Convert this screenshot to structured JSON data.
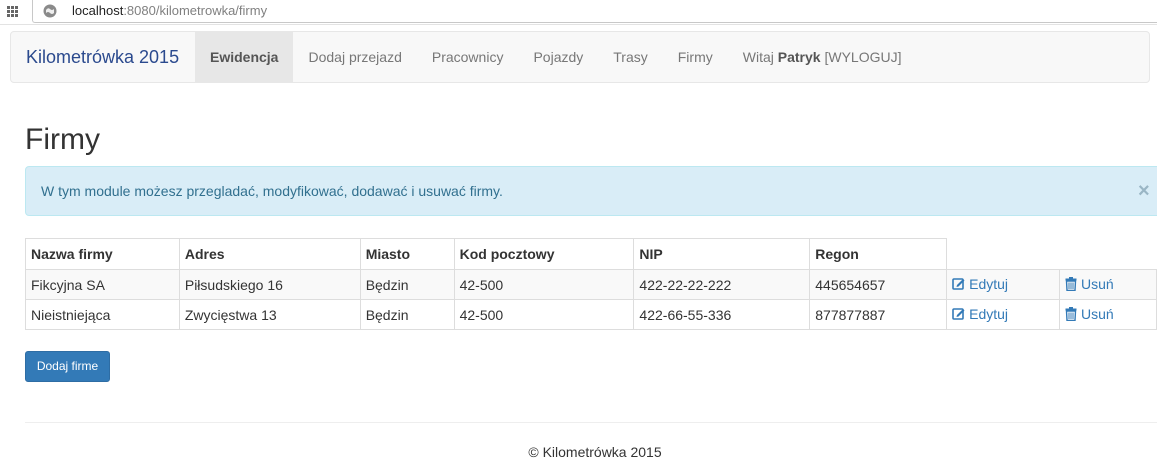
{
  "browser": {
    "url_host": "localhost",
    "url_rest": ":8080/kilometrowka/firmy"
  },
  "navbar": {
    "brand": "Kilometrówka 2015",
    "items": [
      {
        "label": "Ewidencja",
        "active": true
      },
      {
        "label": "Dodaj przejazd"
      },
      {
        "label": "Pracownicy"
      },
      {
        "label": "Pojazdy"
      },
      {
        "label": "Trasy"
      },
      {
        "label": "Firmy"
      }
    ],
    "greeting_prefix": "Witaj",
    "greeting_user": "Patryk",
    "logout_label": "[WYLOGUJ]"
  },
  "page": {
    "title": "Firmy",
    "alert_text": "W tym module możesz przegladać, modyfikować, dodawać i usuwać firmy.",
    "alert_close": "×"
  },
  "table": {
    "headers": [
      "Nazwa firmy",
      "Adres",
      "Miasto",
      "Kod pocztowy",
      "NIP",
      "Regon"
    ],
    "edit_label": "Edytuj",
    "delete_label": "Usuń",
    "rows": [
      {
        "name": "Fikcyjna SA",
        "address": "Piłsudskiego 16",
        "city": "Będzin",
        "postal": "42-500",
        "nip": "422-22-22-222",
        "regon": "445654657"
      },
      {
        "name": "Nieistniejąca",
        "address": "Zwycięstwa 13",
        "city": "Będzin",
        "postal": "42-500",
        "nip": "422-66-55-336",
        "regon": "877877887"
      }
    ]
  },
  "actions": {
    "add_button": "Dodaj firme"
  },
  "footer": {
    "text": "© Kilometrówka 2015"
  },
  "colors": {
    "primary": "#337ab7",
    "alert_bg": "#d9edf7",
    "alert_text": "#31708f",
    "brand": "#2b4a8e"
  }
}
